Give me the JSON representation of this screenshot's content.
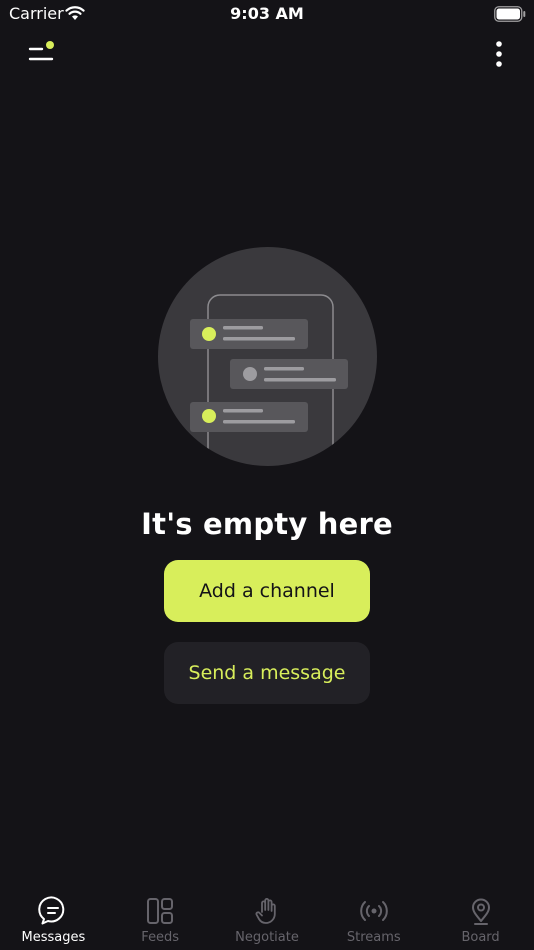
{
  "status_bar": {
    "carrier": "Carrier",
    "time": "9:03 AM"
  },
  "empty_state": {
    "title": "It's empty here",
    "primary_button": "Add a channel",
    "secondary_button": "Send a message"
  },
  "tabs": [
    {
      "label": "Messages",
      "icon": "chat-bubble-icon",
      "active": true
    },
    {
      "label": "Feeds",
      "icon": "layout-grid-icon",
      "active": false
    },
    {
      "label": "Negotiate",
      "icon": "hand-icon",
      "active": false
    },
    {
      "label": "Streams",
      "icon": "broadcast-icon",
      "active": false
    },
    {
      "label": "Board",
      "icon": "map-pin-icon",
      "active": false
    }
  ],
  "colors": {
    "background": "#141317",
    "accent": "#d8ee5b",
    "secondary_button_bg": "#222126",
    "inactive_tab": "#66646b"
  }
}
